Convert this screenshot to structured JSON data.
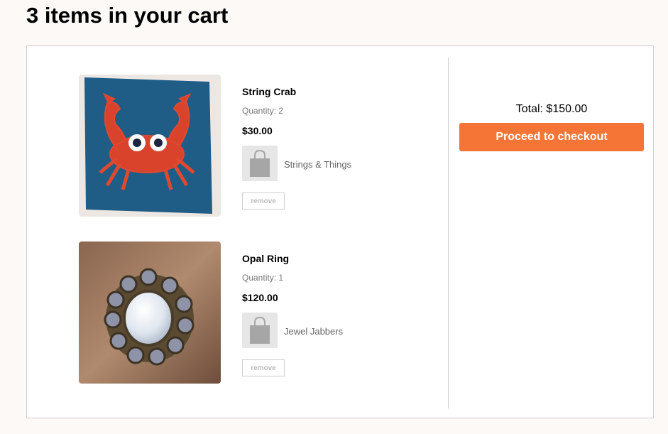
{
  "page": {
    "title": "3 items in your cart"
  },
  "items": [
    {
      "name": "String Crab",
      "quantity": "Quantity: 2",
      "price": "$30.00",
      "shop": "Strings & Things",
      "remove_label": "remove",
      "image_icon": "string-art-crab-image"
    },
    {
      "name": "Opal Ring",
      "quantity": "Quantity: 1",
      "price": "$120.00",
      "shop": "Jewel Jabbers",
      "remove_label": "remove",
      "image_icon": "opal-ring-image"
    }
  ],
  "summary": {
    "total_label": "Total:",
    "total_value": "$150.00",
    "checkout_label": "Proceed to checkout"
  },
  "colors": {
    "accent": "#f47535",
    "border": "#cfcfcf",
    "page_bg": "#fdf9f7"
  }
}
